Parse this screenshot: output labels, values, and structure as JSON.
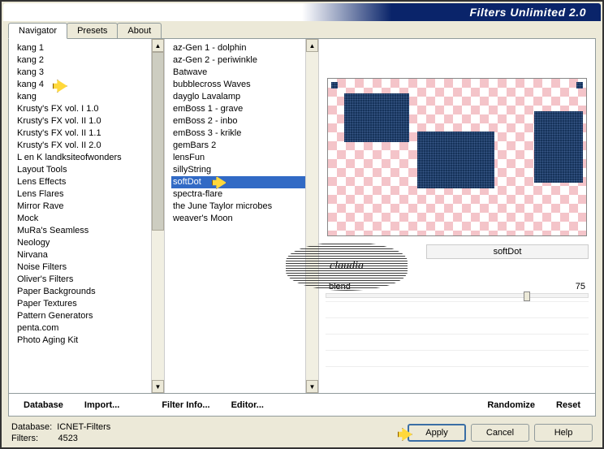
{
  "title": "Filters Unlimited 2.0",
  "tabs": {
    "t0": "Navigator",
    "t1": "Presets",
    "t2": "About"
  },
  "left": {
    "items": [
      "kang 1",
      "kang 2",
      "kang 3",
      "kang 4",
      "kang",
      "Krusty's FX vol. I 1.0",
      "Krusty's FX vol. II 1.0",
      "Krusty's FX vol. II 1.1",
      "Krusty's FX vol. II 2.0",
      "L en K landksiteofwonders",
      "Layout Tools",
      "Lens Effects",
      "Lens Flares",
      "Mirror Rave",
      "Mock",
      "MuRa's Seamless",
      "Neology",
      "Nirvana",
      "Noise Filters",
      "Oliver's Filters",
      "Paper Backgrounds",
      "Paper Textures",
      "Pattern Generators",
      "penta.com",
      "Photo Aging Kit"
    ]
  },
  "mid": {
    "items": [
      "az-Gen 1  -  dolphin",
      "az-Gen 2  -  periwinkle",
      "Batwave",
      "bubblecross Waves",
      "dayglo Lavalamp",
      "emBoss 1  -  grave",
      "emBoss 2  -  inbo",
      "emBoss 3  -  krikle",
      "gemBars 2",
      "lensFun",
      "sillyString",
      "softDot",
      "spectra-flare",
      "the June Taylor microbes",
      "weaver's Moon"
    ],
    "selIndex": 11
  },
  "filterLabel": "softDot",
  "param": {
    "name": "blend",
    "value": "75"
  },
  "btns": {
    "db": "Database",
    "imp": "Import...",
    "fi": "Filter Info...",
    "ed": "Editor...",
    "rnd": "Randomize",
    "rst": "Reset"
  },
  "footer": {
    "dbLabel": "Database:",
    "dbVal": "ICNET-Filters",
    "flLabel": "Filters:",
    "flVal": "4523"
  },
  "dlg": {
    "apply": "Apply",
    "cancel": "Cancel",
    "help": "Help"
  },
  "watermark": "claudia"
}
